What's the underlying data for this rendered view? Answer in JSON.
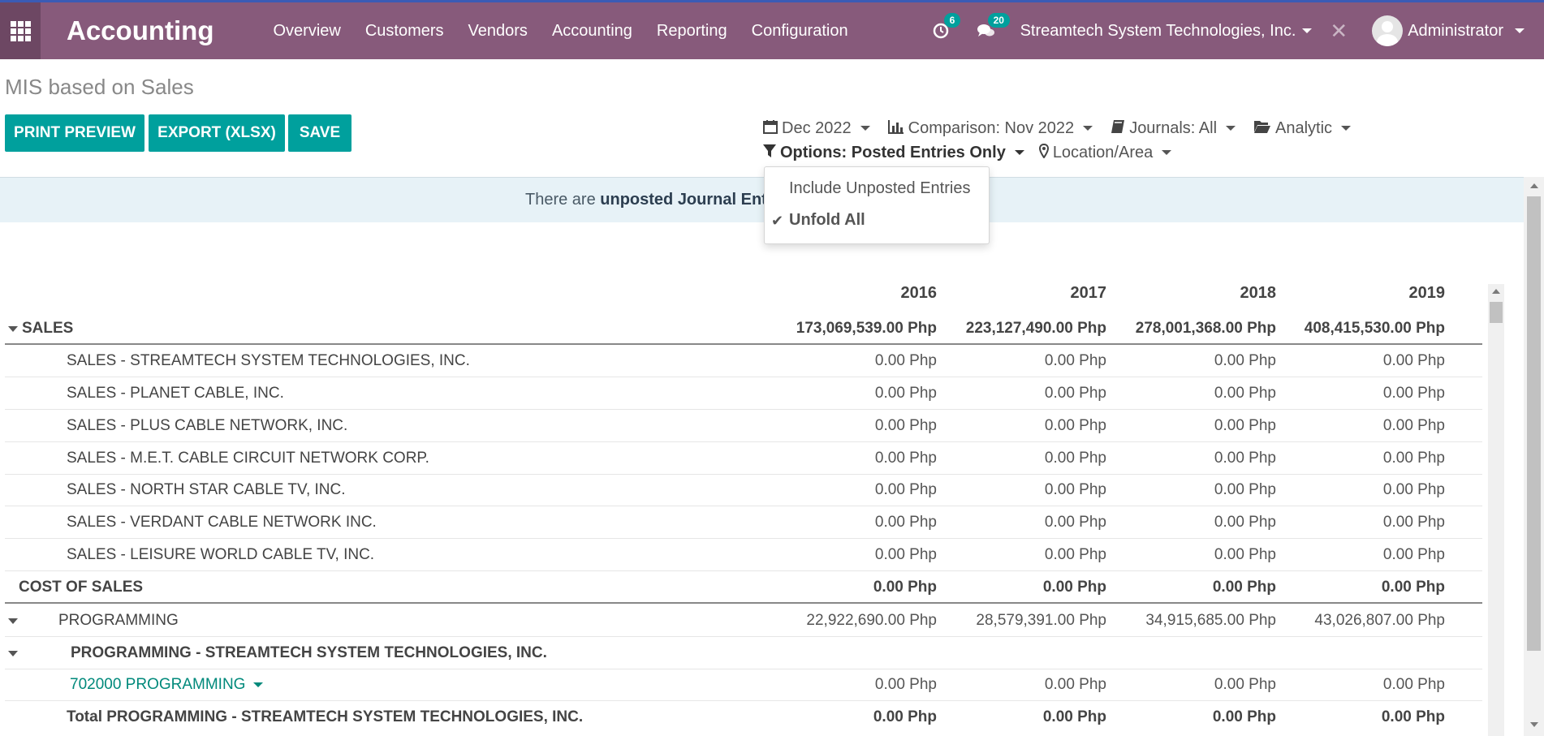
{
  "navbar": {
    "brand": "Accounting",
    "menu": [
      "Overview",
      "Customers",
      "Vendors",
      "Accounting",
      "Reporting",
      "Configuration"
    ],
    "activity_count": "6",
    "messages_count": "20",
    "company": "Streamtech System Technologies, Inc.",
    "user": "Administrator"
  },
  "page": {
    "title": "MIS based on Sales",
    "buttons": {
      "print_preview": "PRINT PREVIEW",
      "export": "EXPORT (XLSX)",
      "save": "SAVE"
    }
  },
  "filters": {
    "date": "Dec 2022",
    "comparison": "Comparison: Nov 2022",
    "journals": "Journals: All",
    "analytic": "Analytic",
    "options": "Options: Posted Entries Only",
    "location": "Location/Area"
  },
  "options_dropdown": {
    "items": [
      {
        "label": "Include Unposted Entries",
        "checked": false
      },
      {
        "label": "Unfold All",
        "checked": true
      }
    ]
  },
  "alert": {
    "prefix": "There are ",
    "bold": "unposted Journal Entrie"
  },
  "report": {
    "columns": [
      "2016",
      "2017",
      "2018",
      "2019"
    ],
    "rows": [
      {
        "label": "SALES",
        "values": [
          "173,069,539.00 Php",
          "223,127,490.00 Php",
          "278,001,368.00 Php",
          "408,415,530.00 Php"
        ]
      },
      {
        "label": "SALES - STREAMTECH SYSTEM TECHNOLOGIES, INC.",
        "values": [
          "0.00 Php",
          "0.00 Php",
          "0.00 Php",
          "0.00 Php"
        ]
      },
      {
        "label": "SALES - PLANET CABLE, INC.",
        "values": [
          "0.00 Php",
          "0.00 Php",
          "0.00 Php",
          "0.00 Php"
        ]
      },
      {
        "label": "SALES - PLUS CABLE NETWORK, INC.",
        "values": [
          "0.00 Php",
          "0.00 Php",
          "0.00 Php",
          "0.00 Php"
        ]
      },
      {
        "label": "SALES - M.E.T. CABLE CIRCUIT NETWORK CORP.",
        "values": [
          "0.00 Php",
          "0.00 Php",
          "0.00 Php",
          "0.00 Php"
        ]
      },
      {
        "label": "SALES - NORTH STAR CABLE TV, INC.",
        "values": [
          "0.00 Php",
          "0.00 Php",
          "0.00 Php",
          "0.00 Php"
        ]
      },
      {
        "label": "SALES - VERDANT CABLE NETWORK INC.",
        "values": [
          "0.00 Php",
          "0.00 Php",
          "0.00 Php",
          "0.00 Php"
        ]
      },
      {
        "label": "SALES - LEISURE WORLD CABLE TV, INC.",
        "values": [
          "0.00 Php",
          "0.00 Php",
          "0.00 Php",
          "0.00 Php"
        ]
      },
      {
        "label": "COST OF SALES",
        "values": [
          "0.00 Php",
          "0.00 Php",
          "0.00 Php",
          "0.00 Php"
        ]
      },
      {
        "label": "PROGRAMMING",
        "values": [
          "22,922,690.00 Php",
          "28,579,391.00 Php",
          "34,915,685.00 Php",
          "43,026,807.00 Php"
        ]
      },
      {
        "label": "PROGRAMMING - STREAMTECH SYSTEM TECHNOLOGIES, INC.",
        "values": [
          "",
          "",
          "",
          ""
        ]
      },
      {
        "label": "702000 PROGRAMMING",
        "values": [
          "0.00 Php",
          "0.00 Php",
          "0.00 Php",
          "0.00 Php"
        ]
      },
      {
        "label": "Total PROGRAMMING - STREAMTECH SYSTEM TECHNOLOGIES, INC.",
        "values": [
          "0.00 Php",
          "0.00 Php",
          "0.00 Php",
          "0.00 Php"
        ]
      }
    ]
  },
  "icons": {
    "apps": "apps-grid-icon",
    "activity": "clock-icon",
    "messages": "comments-icon",
    "debug": "close-icon",
    "date": "calendar-icon",
    "comparison": "bar-chart-icon",
    "journals": "book-icon",
    "analytic": "folder-open-icon",
    "options": "filter-icon",
    "location": "map-marker-icon",
    "check": "check-icon"
  },
  "colors": {
    "navbar": "#875a7b",
    "primary_button": "#00a09d",
    "alert_bg": "#e7f2f7",
    "link": "#00897b"
  }
}
